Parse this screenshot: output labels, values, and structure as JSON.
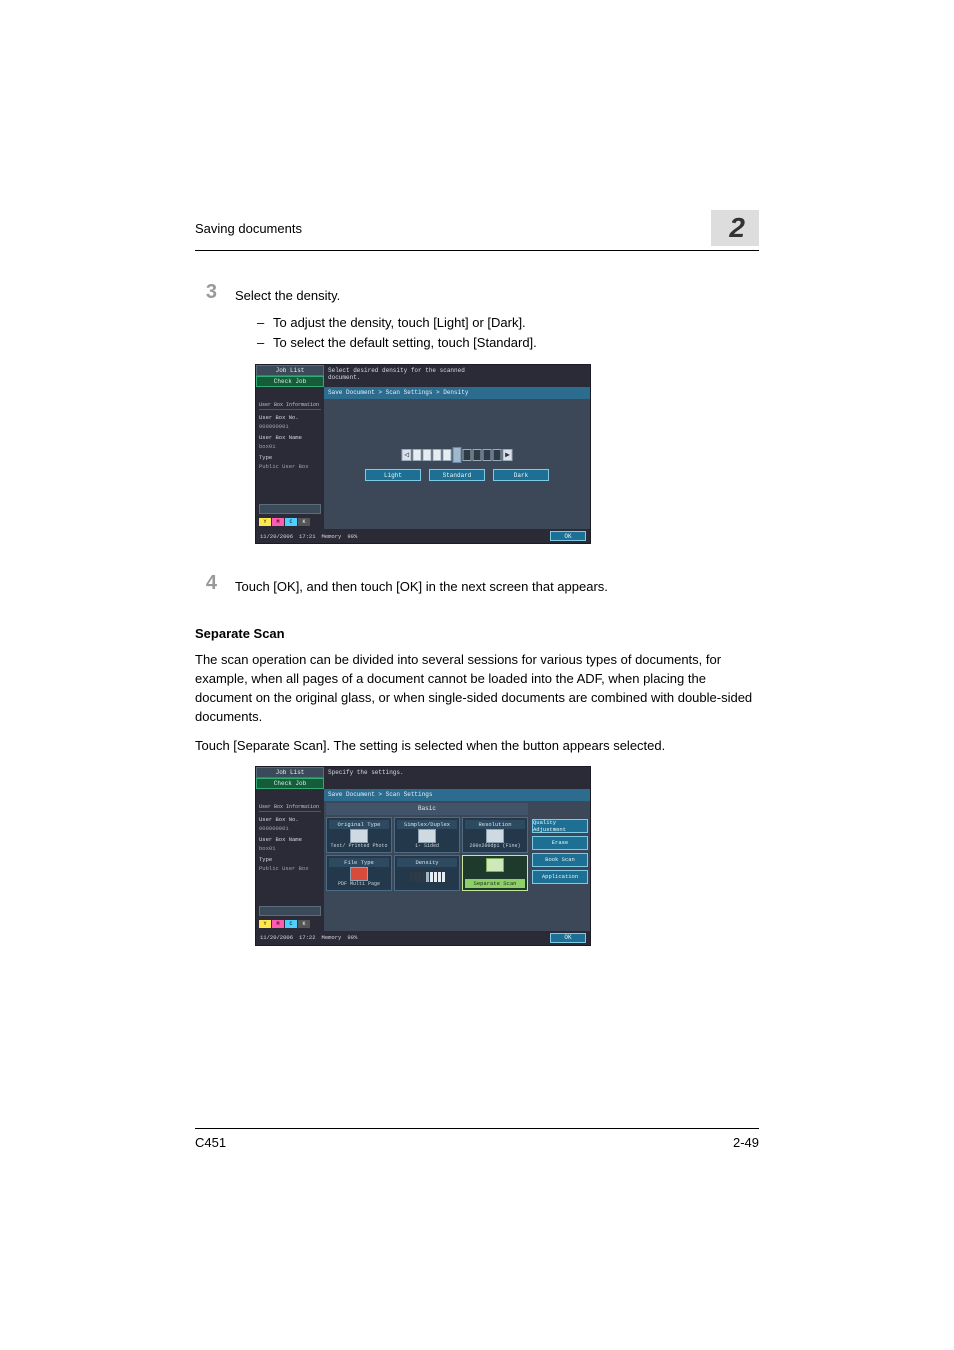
{
  "header": {
    "section_title": "Saving documents",
    "chapter_number": "2"
  },
  "footer": {
    "model": "C451",
    "page": "2-49"
  },
  "steps": {
    "s3": {
      "num": "3",
      "text": "Select the density."
    },
    "s3_bullets": [
      "To adjust the density, touch [Light] or [Dark].",
      "To select the default setting, touch [Standard]."
    ],
    "s4": {
      "num": "4",
      "text": "Touch [OK], and then touch [OK] in the next screen that appears."
    }
  },
  "section": {
    "heading": "Separate Scan",
    "p1": "The scan operation can be divided into several sessions for various types of documents, for example, when all pages of a document cannot be loaded into the ADF, when placing the document on the original glass, or when single-sided documents are combined with double-sided documents.",
    "p2": "Touch [Separate Scan]. The setting is selected when the button appears selected."
  },
  "mfp_density": {
    "job_list": "Job List",
    "check_job": "Check Job",
    "instruction_line1": "Select desired density for the scanned",
    "instruction_line2": "document.",
    "breadcrumb": "Save Document > Scan Settings > Density",
    "side": {
      "info_head": "User Box\nInformation",
      "box_no_lbl": "User Box No.",
      "box_no_val": "000000001",
      "box_name_lbl": "User Box Name",
      "box_name_val": "box01",
      "type_lbl": "Type",
      "type_val": "Public\nUser Box"
    },
    "btn_light": "Light",
    "btn_standard": "Standard",
    "btn_dark": "Dark",
    "footer_date": "11/20/2006",
    "footer_time": "17:21",
    "footer_mem_lbl": "Memory",
    "footer_mem_val": "99%",
    "ok": "OK",
    "ymck": {
      "y": "Y",
      "m": "M",
      "c": "C",
      "k": "K"
    }
  },
  "mfp_basic": {
    "job_list": "Job List",
    "check_job": "Check Job",
    "instruction": "Specify the settings.",
    "breadcrumb": "Save Document > Scan Settings",
    "side": {
      "info_head": "User Box\nInformation",
      "box_no_lbl": "User Box No.",
      "box_no_val": "000000001",
      "box_name_lbl": "User Box Name",
      "box_name_val": "box01",
      "type_lbl": "Type",
      "type_val": "Public\nUser Box"
    },
    "basic_label": "Basic",
    "tiles": {
      "orig_type": {
        "title": "Original Type",
        "sub": "Text/\nPrinted\nPhoto"
      },
      "simplex": {
        "title": "Simplex/Duplex",
        "sub": "1-\nSided"
      },
      "resolution": {
        "title": "Resolution",
        "sub": "200x200dpi\n(Fine)"
      },
      "filetype": {
        "title": "File Type",
        "sub": "PDF\nMulti Page"
      },
      "density": {
        "title": "Density",
        "sub": ""
      },
      "sepscan": {
        "title": "Separate Scan",
        "sub": ""
      }
    },
    "sidetabs": {
      "quality": "Quality\nAdjustment",
      "erase": "Erase",
      "bookscan": "Book Scan",
      "application": "Application"
    },
    "footer_date": "11/20/2006",
    "footer_time": "17:22",
    "footer_mem_lbl": "Memory",
    "footer_mem_val": "99%",
    "ok": "OK",
    "ymck": {
      "y": "Y",
      "m": "M",
      "c": "C",
      "k": "K"
    }
  }
}
